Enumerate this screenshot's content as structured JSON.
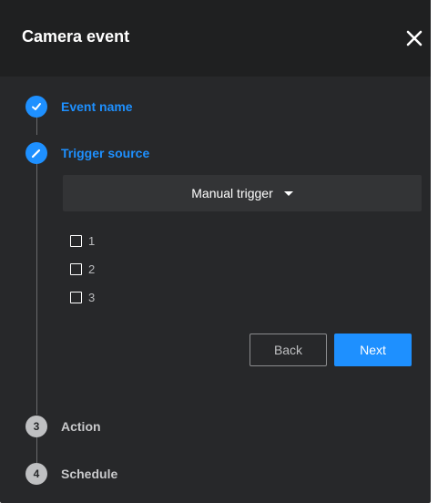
{
  "dialog": {
    "title": "Camera event",
    "close_icon": "close-icon"
  },
  "steps": [
    {
      "label": "Event name",
      "state": "completed",
      "icon": "check-icon"
    },
    {
      "label": "Trigger source",
      "state": "active",
      "icon": "pencil-icon"
    },
    {
      "label": "Action",
      "state": "pending",
      "number": "3"
    },
    {
      "label": "Schedule",
      "state": "pending",
      "number": "4"
    }
  ],
  "trigger": {
    "selected": "Manual trigger",
    "options": [
      {
        "label": "1",
        "checked": false
      },
      {
        "label": "2",
        "checked": false
      },
      {
        "label": "3",
        "checked": false
      }
    ]
  },
  "buttons": {
    "back": "Back",
    "next": "Next"
  },
  "colors": {
    "accent": "#1e90ff",
    "background": "#27282a",
    "header": "#1f2021"
  }
}
